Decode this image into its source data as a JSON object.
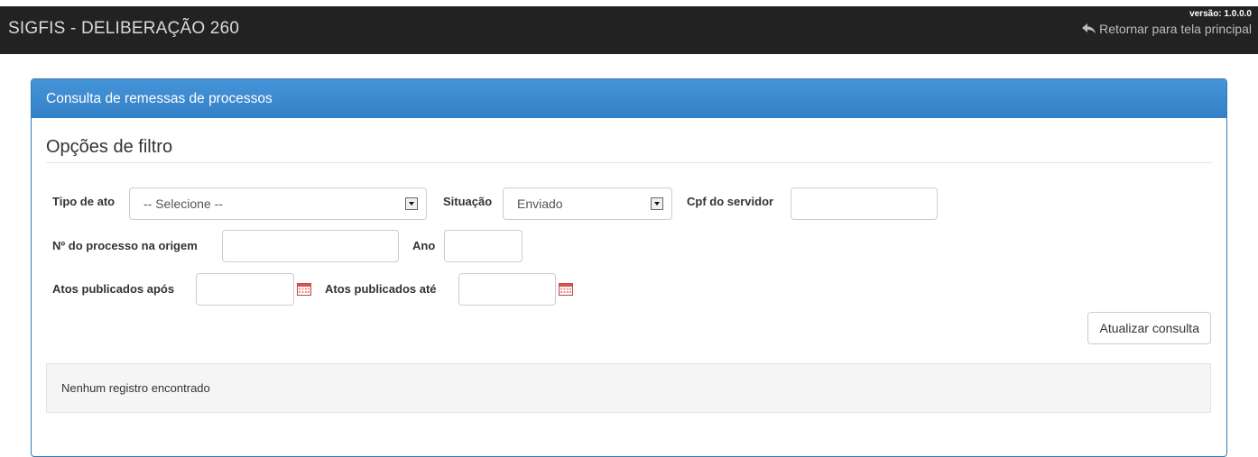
{
  "header": {
    "app_title": "SIGFIS - DELIBERAÇÃO 260",
    "version": "versão: 1.0.0.0",
    "return_label": "Retornar para tela principal"
  },
  "panel": {
    "title": "Consulta de remessas de processos",
    "filter_title": "Opções de filtro"
  },
  "filters": {
    "tipo_ato_label": "Tipo de ato",
    "tipo_ato_value": "-- Selecione --",
    "situacao_label": "Situação",
    "situacao_value": "Enviado",
    "cpf_label": "Cpf do servidor",
    "cpf_value": "",
    "processo_label": "Nº do processo na origem",
    "processo_value": "",
    "ano_label": "Ano",
    "ano_value": "",
    "apos_label": "Atos publicados após",
    "apos_value": "",
    "ate_label": "Atos publicados até",
    "ate_value": ""
  },
  "actions": {
    "refresh_label": "Atualizar consulta"
  },
  "results": {
    "empty_message": "Nenhum registro encontrado"
  },
  "colors": {
    "topbar": "#222222",
    "panel_heading": "#3c8dd3",
    "panel_border": "#337ab7"
  }
}
